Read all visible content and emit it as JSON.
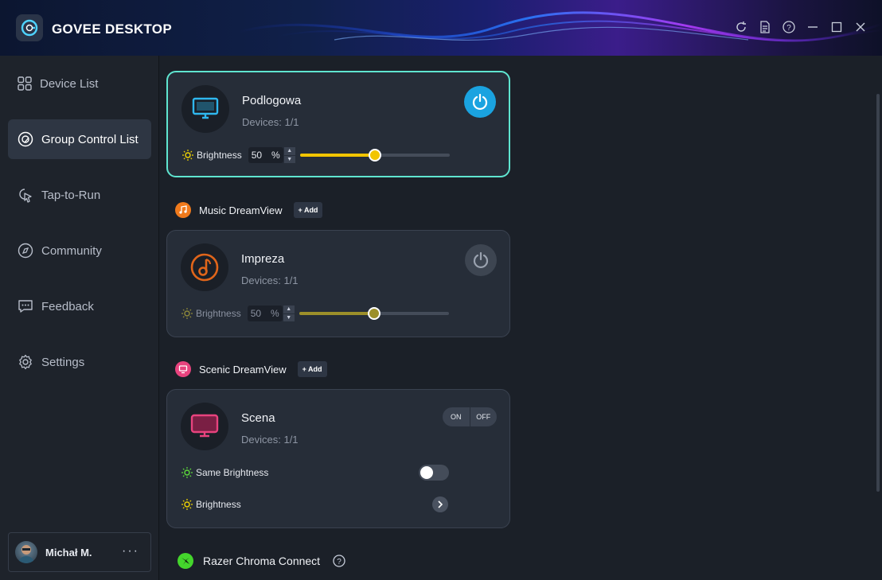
{
  "app": {
    "title": "GOVEE DESKTOP"
  },
  "window_controls": [
    {
      "name": "refresh-icon"
    },
    {
      "name": "document-icon"
    },
    {
      "name": "help-icon"
    },
    {
      "name": "minimize-icon"
    },
    {
      "name": "maximize-icon"
    },
    {
      "name": "close-icon"
    }
  ],
  "sidebar": {
    "items": [
      {
        "label": "Device List",
        "icon": "grid-icon",
        "active": false
      },
      {
        "label": "Group Control List",
        "icon": "group-icon",
        "active": true
      },
      {
        "label": "Tap-to-Run",
        "icon": "cursor-click-icon",
        "active": false
      },
      {
        "label": "Community",
        "icon": "compass-icon",
        "active": false
      },
      {
        "label": "Feedback",
        "icon": "feedback-icon",
        "active": false
      },
      {
        "label": "Settings",
        "icon": "gear-icon",
        "active": false
      }
    ],
    "user": {
      "name": "Michał M.",
      "more": "···"
    }
  },
  "groups": {
    "podlogowa": {
      "name": "Podlogowa",
      "devices": "Devices: 1/1",
      "brightness_label": "Brightness",
      "brightness": "50",
      "unit": "%",
      "level": 0.5,
      "power": "on",
      "accent": "#f2c500"
    },
    "music": {
      "header": "Music DreamView",
      "add": "+ Add",
      "card": {
        "name": "Impreza",
        "devices": "Devices: 1/1",
        "brightness_label": "Brightness",
        "brightness": "50",
        "unit": "%",
        "level": 0.5,
        "power": "off",
        "accent": "#9c8f2a"
      }
    },
    "scenic": {
      "header": "Scenic DreamView",
      "add": "+ Add",
      "card": {
        "name": "Scena",
        "devices": "Devices: 1/1",
        "on": "ON",
        "off": "OFF",
        "same_brightness": "Same Brightness",
        "brightness_label": "Brightness",
        "same_brightness_enabled": false
      }
    },
    "razer": {
      "label": "Razer Chroma Connect"
    }
  },
  "colors": {
    "accent_cyan": "#5fe5d0",
    "power_blue": "#1aa3e0",
    "music_orange": "#f07a1c",
    "scenic_pink": "#e8437e",
    "razer_green": "#44d62c"
  }
}
